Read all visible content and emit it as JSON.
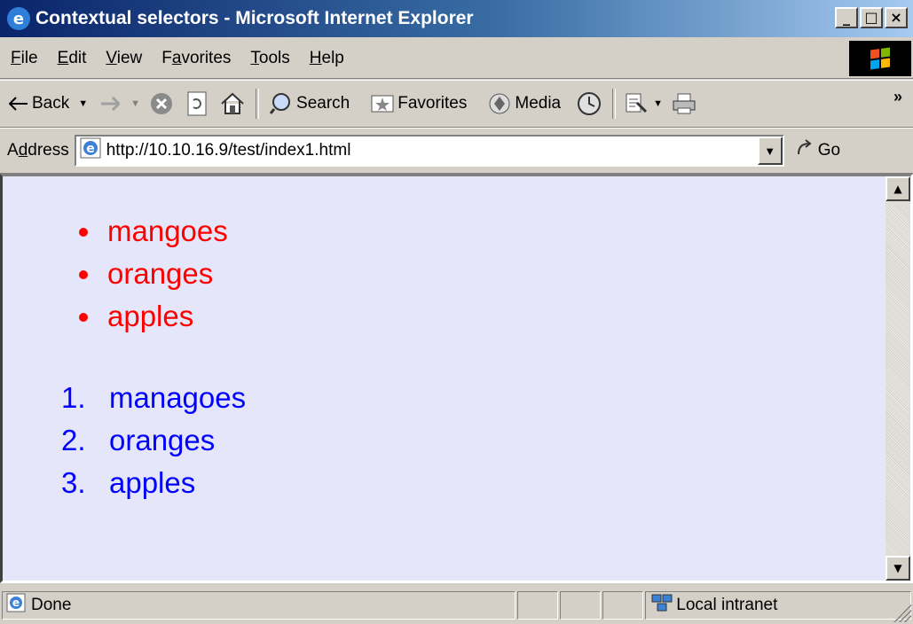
{
  "window": {
    "title": "Contextual selectors - Microsoft Internet Explorer",
    "minimize": "_",
    "maximize": "□",
    "close": "×"
  },
  "menu": [
    {
      "label_u": "F",
      "label_rest": "ile"
    },
    {
      "label_u": "E",
      "label_rest": "dit"
    },
    {
      "label_u": "V",
      "label_rest": "iew"
    },
    {
      "label_pre": "F",
      "label_u": "a",
      "label_rest": "vorites"
    },
    {
      "label_u": "T",
      "label_rest": "ools"
    },
    {
      "label_u": "H",
      "label_rest": "elp"
    }
  ],
  "toolbar": {
    "back": "Back",
    "search": "Search",
    "favorites": "Favorites",
    "media": "Media",
    "more": "»"
  },
  "address": {
    "label_pre": "A",
    "label_u": "d",
    "label_rest": "dress",
    "url": "http://10.10.16.9/test/index1.html",
    "go": "Go"
  },
  "content": {
    "unordered": [
      "mangoes",
      "oranges",
      "apples"
    ],
    "ordered": [
      {
        "num": "1.",
        "text": "managoes"
      },
      {
        "num": "2.",
        "text": "oranges"
      },
      {
        "num": "3.",
        "text": "apples"
      }
    ],
    "colors": {
      "unordered": "#ff0000",
      "ordered": "#0000ff",
      "background": "#e6e6fa"
    }
  },
  "status": {
    "text": "Done",
    "zone": "Local intranet"
  }
}
